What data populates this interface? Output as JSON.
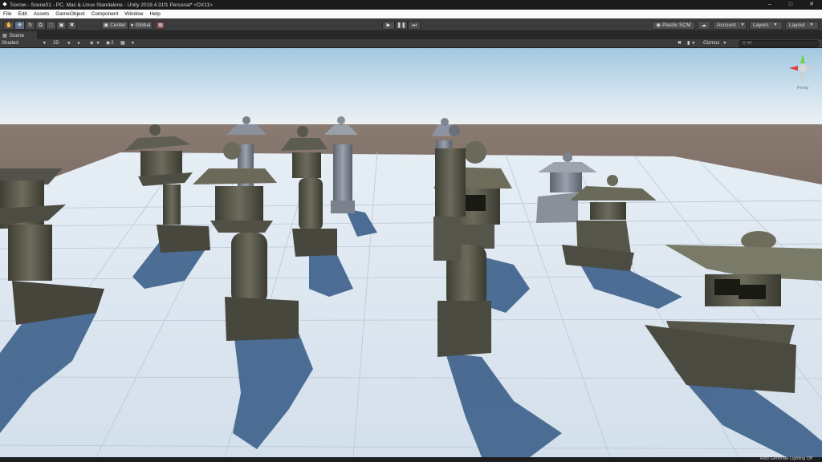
{
  "window": {
    "title": "Toxrow - Scene01 - PC, Mac & Linux Standalone - Unity 2019.4.31f1 Personal* <DX11>",
    "controls": [
      "–",
      "□",
      "✕"
    ]
  },
  "menu": [
    "File",
    "Edit",
    "Assets",
    "GameObject",
    "Component",
    "Window",
    "Help"
  ],
  "toolbar": {
    "pivot_label": "Center",
    "space_label": "Global",
    "plastic_label": "Plastic SCM",
    "account_label": "Account",
    "layers_label": "Layers",
    "layout_label": "Layout"
  },
  "scene_tab": {
    "label": "Scene"
  },
  "scene_toolbar": {
    "shading_mode": "Shaded",
    "mode_2d": "2D",
    "fx_count": "2",
    "gizmos_label": "Gizmos",
    "search_placeholder": "All"
  },
  "gizmo": {
    "view_label": "Persp"
  },
  "status": {
    "text": "Auto Generate Lighting Off"
  },
  "colors": {
    "sky_top": "#9ec6e4",
    "horizon": "#e4eef4",
    "ground_far": "#5a4a42",
    "floor": "#dfe8f2",
    "shadow": "#3d5d86",
    "stone_dark": "#4a4a40",
    "stone_light": "#8a8a78"
  }
}
